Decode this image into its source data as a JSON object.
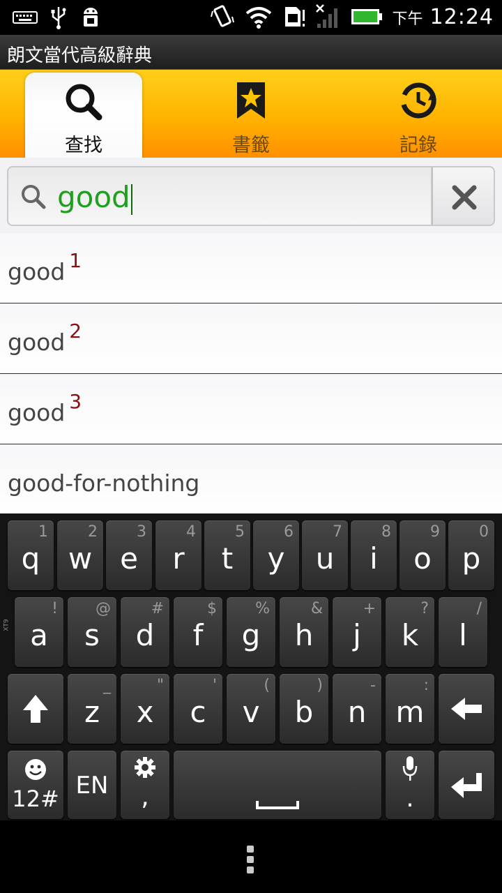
{
  "status": {
    "ampm": "下午",
    "time": "12:24"
  },
  "app_title": "朗文當代高級辭典",
  "tabs": [
    {
      "label": "查找",
      "icon": "search-icon",
      "active": true
    },
    {
      "label": "書籤",
      "icon": "bookmark-star-icon",
      "active": false
    },
    {
      "label": "記錄",
      "icon": "history-clock-icon",
      "active": false
    }
  ],
  "search": {
    "value": "good"
  },
  "results": [
    {
      "word": "good",
      "sup": "1"
    },
    {
      "word": "good",
      "sup": "2"
    },
    {
      "word": "good",
      "sup": "3"
    },
    {
      "word": "good-for-nothing",
      "sup": ""
    }
  ],
  "keyboard": {
    "row1": [
      {
        "ch": "q",
        "alt": "1"
      },
      {
        "ch": "w",
        "alt": "2"
      },
      {
        "ch": "e",
        "alt": "3"
      },
      {
        "ch": "r",
        "alt": "4"
      },
      {
        "ch": "t",
        "alt": "5"
      },
      {
        "ch": "y",
        "alt": "6"
      },
      {
        "ch": "u",
        "alt": "7"
      },
      {
        "ch": "i",
        "alt": "8"
      },
      {
        "ch": "o",
        "alt": "9"
      },
      {
        "ch": "p",
        "alt": "0"
      }
    ],
    "row2": [
      {
        "ch": "a",
        "alt": "!"
      },
      {
        "ch": "s",
        "alt": "@"
      },
      {
        "ch": "d",
        "alt": "#"
      },
      {
        "ch": "f",
        "alt": "$"
      },
      {
        "ch": "g",
        "alt": "%"
      },
      {
        "ch": "h",
        "alt": "&"
      },
      {
        "ch": "j",
        "alt": "+"
      },
      {
        "ch": "k",
        "alt": "?"
      },
      {
        "ch": "l",
        "alt": "/"
      }
    ],
    "row3": [
      {
        "ch": "z",
        "alt": "_"
      },
      {
        "ch": "x",
        "alt": "\""
      },
      {
        "ch": "c",
        "alt": "'"
      },
      {
        "ch": "v",
        "alt": "("
      },
      {
        "ch": "b",
        "alt": ")"
      },
      {
        "ch": "n",
        "alt": "-"
      },
      {
        "ch": "m",
        "alt": ":"
      }
    ],
    "symbols_label": "12#",
    "lang_label": "EN",
    "comma_label": ",",
    "period_label": ".",
    "xt9_label": "XT9"
  }
}
